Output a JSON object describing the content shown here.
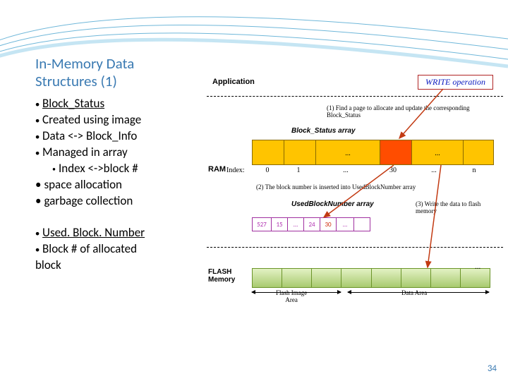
{
  "title_l1": "In-Memory Data",
  "title_l2": "Structures (1)",
  "bullets": {
    "b1": "Block_Status",
    "b2": "Created using image",
    "b3": "Data <-> Block_Info",
    "b4": "Managed in array",
    "b4a": "Index <->block #",
    "b5": "space allocation",
    "b6": "garbage collection",
    "b7": "Used. Block. Number",
    "b8": "Block # of allocated",
    "b8_l2": "block"
  },
  "diagram": {
    "application": "Application",
    "write_op": "WRITE operation",
    "step1": "(1) Find a page to allocate and update the corresponding Block_Status",
    "bs_label": "Block_Status array",
    "ram": "RAM",
    "index_label": "Index:",
    "bs_cells": [
      "",
      "",
      "...",
      "",
      "...",
      ""
    ],
    "bs_index": [
      "0",
      "1",
      "...",
      "30",
      "...",
      "n"
    ],
    "step2": "(2) The block number is inserted into UsedBlockNumber array",
    "ubn_label": "UsedBlockNumber array",
    "step3": "(3) Write the data to flash memory",
    "ubn_cells": [
      "527",
      "15",
      "...",
      "24",
      "30",
      "...",
      ""
    ],
    "flash_label_l1": "FLASH",
    "flash_label_l2": "Memory",
    "flash_dots": "...",
    "flash_image_area": "Flash Image",
    "flash_image_area2": "Area",
    "data_area": "Data Area"
  },
  "page_number": "34"
}
